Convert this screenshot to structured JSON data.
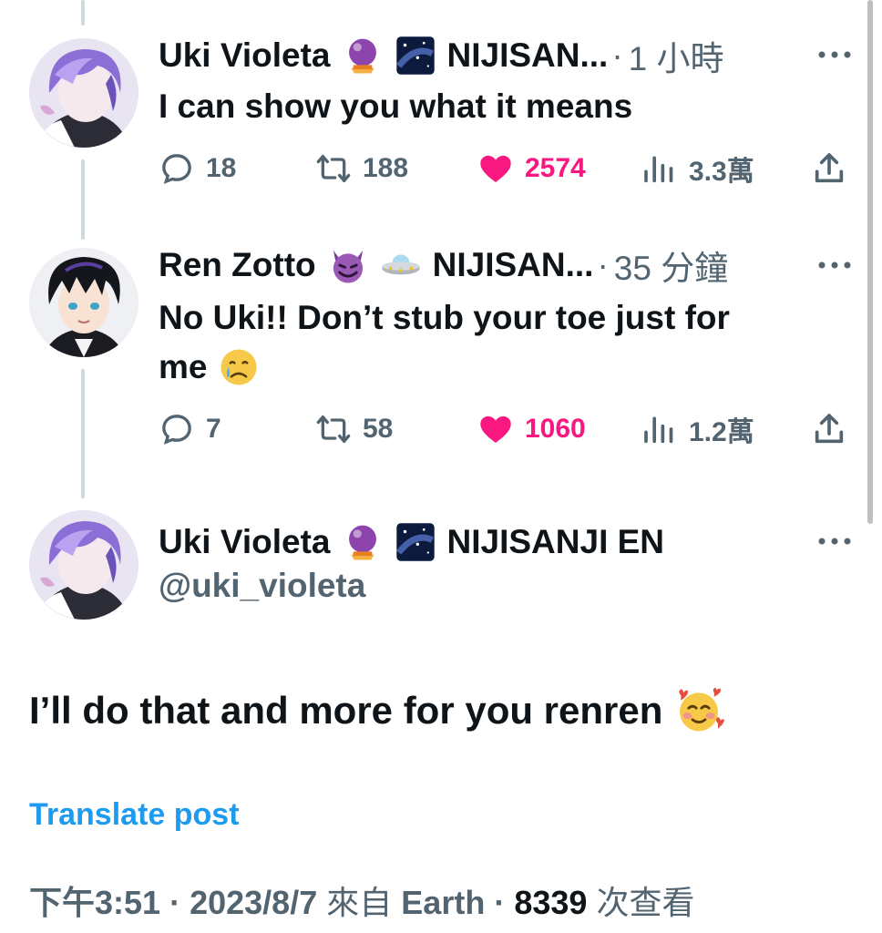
{
  "colors": {
    "accent": "#1d9bf0",
    "like": "#f91880",
    "secondary": "#536471",
    "text": "#0f1419"
  },
  "replies": [
    {
      "name": "Uki Violeta",
      "emojis": [
        "crystal-ball",
        "milky-way"
      ],
      "affiliation": "NIJISAN...",
      "separator": "·",
      "time": "1 小時",
      "text": "I can show you what it means",
      "stats": {
        "replies": "18",
        "reposts": "188",
        "likes": "2574",
        "views": "3.3萬"
      }
    },
    {
      "name": "Ren Zotto",
      "emojis": [
        "smiling-devil",
        "ufo"
      ],
      "affiliation": "NIJISAN...",
      "separator": "·",
      "time": "35 分鐘",
      "text_line1": "No Uki!! Don’t stub your toe just for",
      "text_line2": "me",
      "text_emoji": "crying-face",
      "stats": {
        "replies": "7",
        "reposts": "58",
        "likes": "1060",
        "views": "1.2萬"
      }
    }
  ],
  "main_post": {
    "name": "Uki Violeta",
    "emojis": [
      "crystal-ball",
      "milky-way"
    ],
    "affiliation": "NIJISANJI EN",
    "handle": "@uki_violeta",
    "text": "I’ll do that and more for you renren",
    "text_emoji": "smiling-face-with-hearts",
    "translate_label": "Translate post",
    "time": "下午3:51",
    "dot1": "·",
    "date": "2023/8/7",
    "source_prefix": "來自",
    "source": "Earth",
    "dot2": "·",
    "views_count": "8339",
    "views_label": "次查看"
  }
}
